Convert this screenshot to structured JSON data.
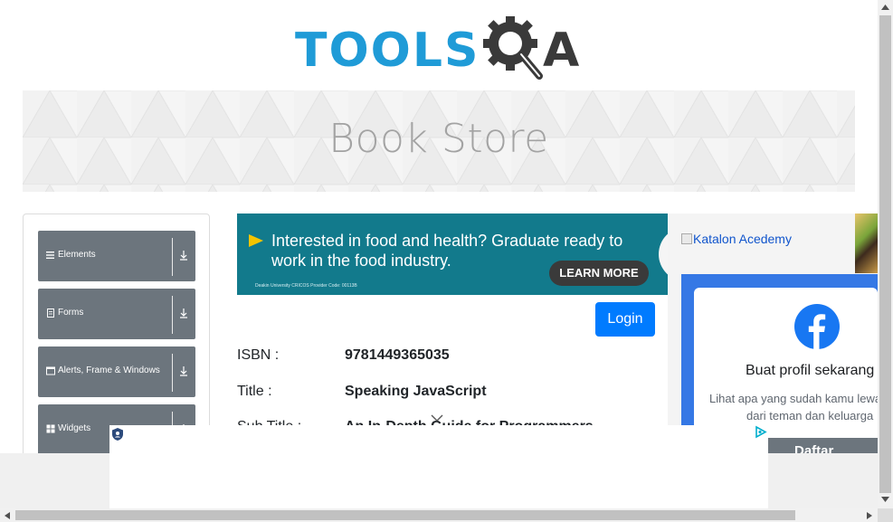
{
  "header": {
    "logo_text_left": "TOOLS",
    "logo_text_right": "A"
  },
  "banner": {
    "title": "Book Store"
  },
  "sidebar": {
    "groups": [
      {
        "label": "Elements",
        "icon": "hamburger-icon"
      },
      {
        "label": "Forms",
        "icon": "document-icon"
      },
      {
        "label": "Alerts, Frame & Windows",
        "icon": "window-icon"
      },
      {
        "label": "Widgets",
        "icon": "grid-icon"
      }
    ]
  },
  "ad": {
    "headline": "Interested in food and health? Graduate ready to work in the food industry.",
    "cta": "LEARN MORE",
    "fine_print": "Deakin University CRICOS Provider Code: 00113B",
    "background": "#127a8c"
  },
  "login": {
    "label": "Login",
    "color": "#007bff"
  },
  "book": {
    "isbn_label": "ISBN :",
    "isbn_value": "9781449365035",
    "title_label": "Title :",
    "title_value": "Speaking JavaScript",
    "subtitle_label": "Sub Title :",
    "subtitle_value": "An In-Depth Guide for Programmers"
  },
  "right_ad": {
    "image_alt": "Katalon Acedemy",
    "fb_title": "Buat profil sekarang",
    "fb_sub1": "Lihat apa yang sudah kamu lewatkan",
    "fb_sub2": "dari teman dan keluarga",
    "fb_cta": "Daftar",
    "fb_color": "#1877f2"
  }
}
